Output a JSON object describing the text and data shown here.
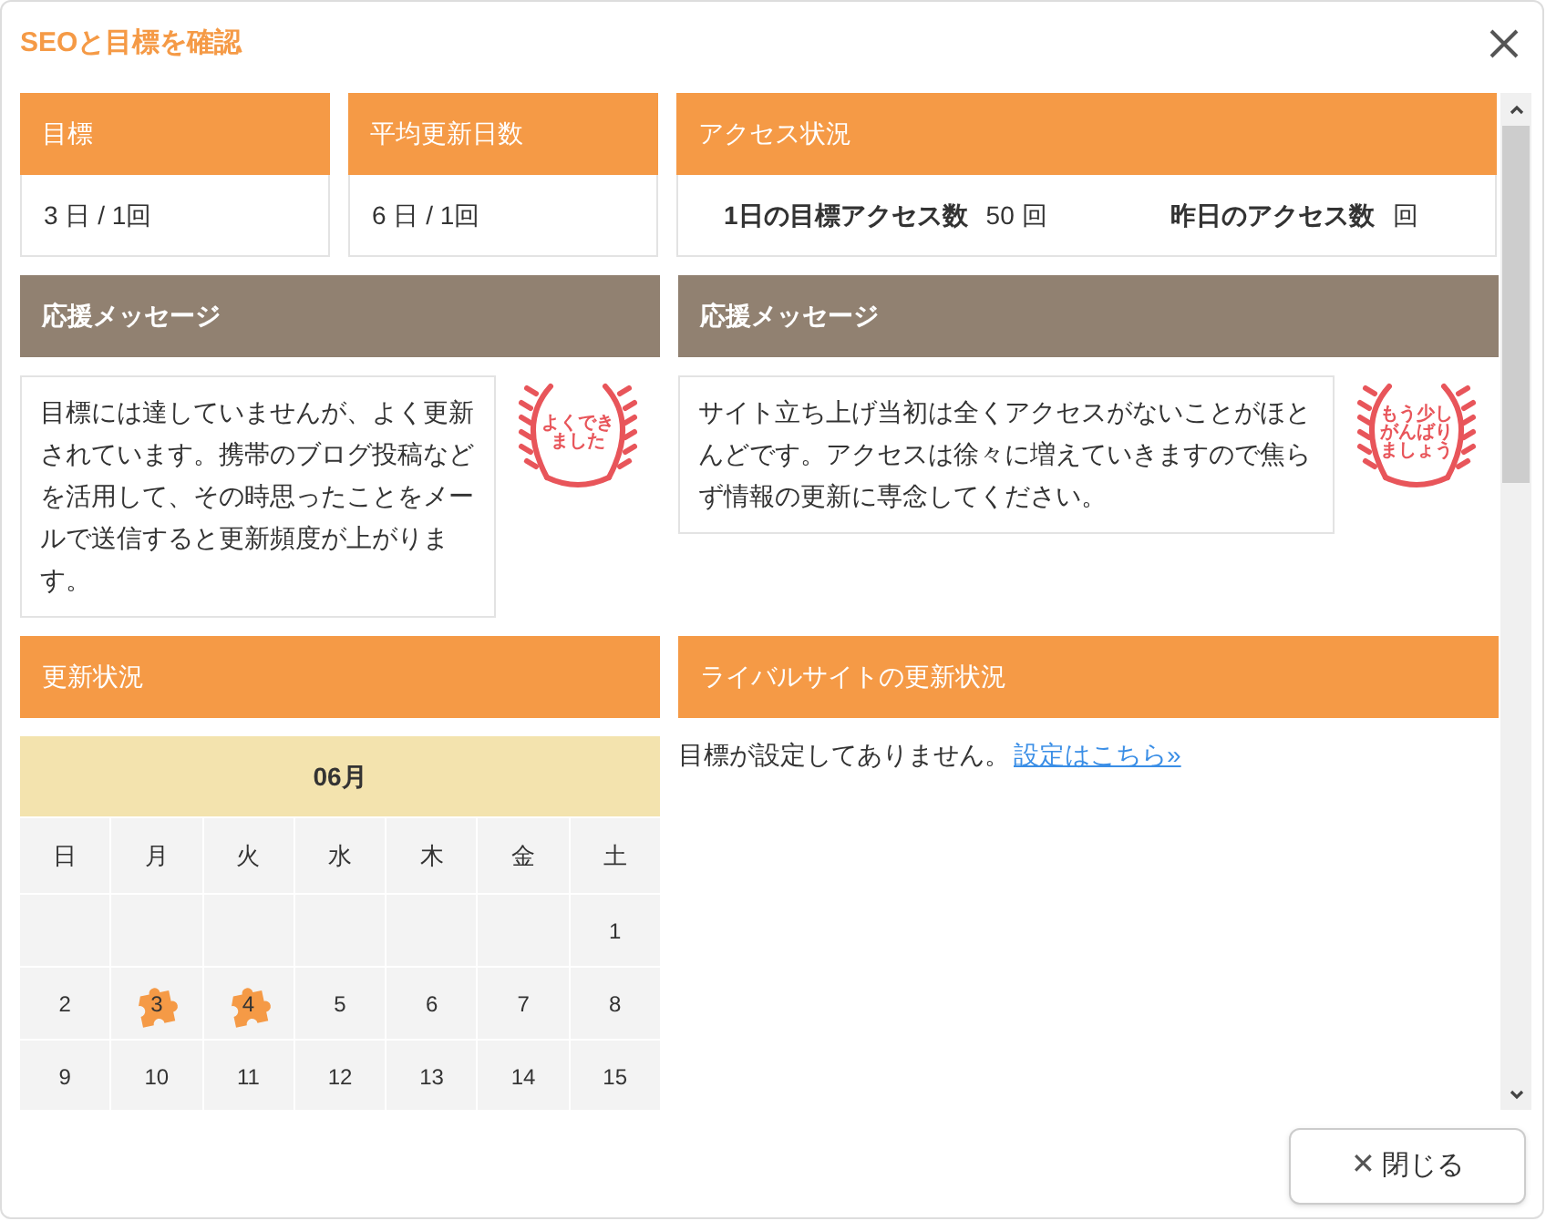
{
  "window": {
    "title": "SEOと目標を確認"
  },
  "stats": [
    {
      "label": "目標",
      "value": "3 日 / 1回"
    },
    {
      "label": "平均更新日数",
      "value": "6 日 / 1回"
    }
  ],
  "access": {
    "title": "アクセス状況",
    "items": [
      {
        "label": "1日の目標アクセス数",
        "value": "50 回"
      },
      {
        "label": "昨日のアクセス数",
        "value": "回"
      }
    ]
  },
  "messages": [
    {
      "title": "応援メッセージ",
      "text": "目標には達していませんが、よく更新されています。携帯のブログ投稿などを活用して、その時思ったことをメールで送信すると更新頻度が上がります。",
      "stamp": [
        "よくでき",
        "ました"
      ]
    },
    {
      "title": "応援メッセージ",
      "text": "サイト立ち上げ当初は全くアクセスがないことがほとんどです。アクセスは徐々に増えていきますので焦らず情報の更新に専念してください。",
      "stamp": [
        "もう少し",
        "がんばり",
        "ましょう"
      ]
    }
  ],
  "update_status": {
    "title": "更新状況",
    "month": "06月",
    "weekdays": [
      "日",
      "月",
      "火",
      "水",
      "木",
      "金",
      "土"
    ],
    "weeks": [
      [
        {
          "day": "1",
          "marked": false
        }
      ],
      [
        {
          "day": "2",
          "marked": false
        },
        {
          "day": "3",
          "marked": true
        },
        {
          "day": "4",
          "marked": true
        },
        {
          "day": "5",
          "marked": false
        },
        {
          "day": "6",
          "marked": false
        },
        {
          "day": "7",
          "marked": false
        },
        {
          "day": "8",
          "marked": false
        }
      ],
      [
        {
          "day": "9",
          "marked": false
        },
        {
          "day": "10",
          "marked": false
        },
        {
          "day": "11",
          "marked": false
        },
        {
          "day": "12",
          "marked": false
        },
        {
          "day": "13",
          "marked": false
        },
        {
          "day": "14",
          "marked": false
        },
        {
          "day": "15",
          "marked": false
        }
      ]
    ]
  },
  "rivals": {
    "title": "ライバルサイトの更新状況",
    "text": "目標が設定してありません。",
    "link": "設定はこちら»"
  },
  "close_button": {
    "icon": "✕",
    "label": "閉じる"
  }
}
